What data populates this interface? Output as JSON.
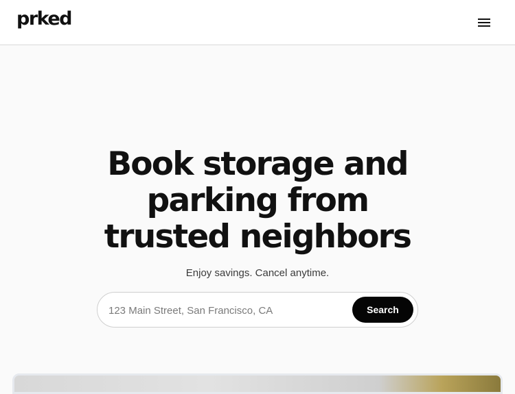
{
  "header": {
    "logo_text": "prked",
    "menu_icon": "hamburger-menu-icon"
  },
  "hero": {
    "title_lines": [
      "Book storage and",
      "parking from",
      "trusted neighbors"
    ],
    "subtitle": "Enjoy savings. Cancel anytime."
  },
  "search": {
    "placeholder": "123 Main Street, San Francisco, CA",
    "value": "",
    "button_label": "Search"
  },
  "colors": {
    "background": "#fafafa",
    "header_background": "#ffffff",
    "text_primary": "#111111",
    "button_background": "#050505",
    "button_text": "#ffffff"
  }
}
